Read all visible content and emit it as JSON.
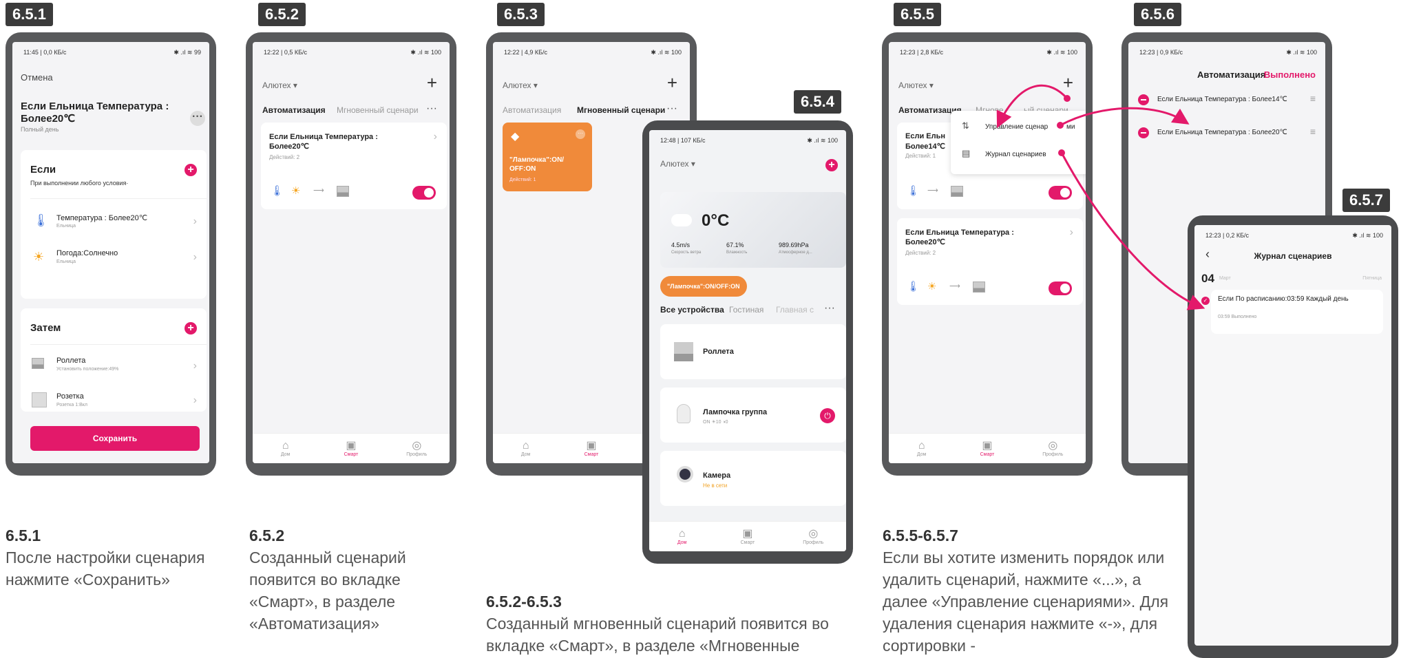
{
  "tags": {
    "t651": "6.5.1",
    "t652": "6.5.2",
    "t653": "6.5.3",
    "t654": "6.5.4",
    "t655": "6.5.5",
    "t656": "6.5.6",
    "t657": "6.5.7"
  },
  "p1": {
    "status": "11:45 | 0,0 КБ/с",
    "status_right": "✱ .ıl ≋ 99",
    "cancel": "Отмена",
    "title": "Если Ельница Температура : Более20℃",
    "subtitle": "Полный день",
    "if_title": "Если",
    "if_sub": "При выполнении любого условия·",
    "cond1": "Температура : Более20℃",
    "cond1_sub": "Ельница",
    "cond2": "Погода:Солнечно",
    "cond2_sub": "Ельница",
    "then_title": "Затем",
    "act1": "Роллета",
    "act1_sub": "Установить положение:49%",
    "act2": "Розетка",
    "act2_sub": "Розетка 1:Вкл",
    "save": "Сохранить"
  },
  "p2": {
    "status": "12:22 | 0,5 КБ/с",
    "status_right": "✱ .ıl ≋ 100",
    "home": "Алютех ▾",
    "tab1": "Автоматизация",
    "tab2": "Мгновенный сценари",
    "card_title": "Если Ельница Температура : Более20℃",
    "card_sub": "Действий: 2"
  },
  "p3": {
    "status": "12:22 | 4,9 КБ/с",
    "status_right": "✱ .ıl ≋ 100",
    "home": "Алютех ▾",
    "tab1": "Автоматизация",
    "tab2": "Мгновенный сценари",
    "scene_title": "\"Лампочка\":ON/ OFF:ON",
    "scene_sub": "Действий: 1"
  },
  "p4": {
    "status": "12:48 | 107 КБ/с",
    "status_right": "✱ .ıl ≋ 100",
    "home": "Алютех ▾",
    "temp": "0°C",
    "wind": "4.5m/s",
    "wind_l": "Скорость ветра",
    "hum": "67.1%",
    "hum_l": "Влажность",
    "press": "989.69hPa",
    "press_l": "Атмосферное д...",
    "chip": "\"Лампочка\":ON/OFF:ON",
    "tab1": "Все устройства",
    "tab2": "Гостиная",
    "tab3": "Главная с",
    "dev1": "Роллета",
    "dev2": "Лампочка группа",
    "dev2_sub": "ON ☀10 ◑0",
    "dev3": "Камера",
    "dev3_sub": "Не в сети"
  },
  "nav": {
    "home": "Дом",
    "smart": "Смарт",
    "profile": "Профиль"
  },
  "p5": {
    "status": "12:23 | 2,8 КБ/с",
    "status_right": "✱ .ıl ≋ 100",
    "home": "Алютех ▾",
    "tab1": "Автоматизация",
    "tab2": "Мгнове",
    "tab2b": "ый сценари",
    "menu1": "Управление сценар",
    "menu1b": "ми",
    "menu2": "Журнал сценариев",
    "card1": "Если Ельн",
    "card1b": "Более14℃",
    "card1_sub": "Действий: 1",
    "card2": "Если Ельница Температура : Более20℃",
    "card2_sub": "Действий: 2"
  },
  "p6": {
    "status": "12:23 | 0,9 КБ/с",
    "status_right": "✱ .ıl ≋ 100",
    "title": "Автоматизация",
    "done": "Выполнено",
    "item1": "Если Ельница Температура : Более14℃",
    "item2": "Если Ельница Температура : Более20℃"
  },
  "p7": {
    "status": "12:23 | 0,2 КБ/с",
    "status_right": "✱ .ıl ≋ 100",
    "title": "Журнал сценариев",
    "day": "04",
    "month": "Март",
    "weekday": "Пятница",
    "log": "Если По расписанию:03:59 Каждый день",
    "log_sub": "03:59 Выполнено"
  },
  "captions": {
    "c1h": "6.5.1",
    "c1": "После настройки сценария нажмите «Сохранить»",
    "c2h": "6.5.2",
    "c2": "Созданный сценарий появится во вкладке «Смарт», в разделе «Автоматизация»",
    "c3h": "6.5.2-6.5.3",
    "c3": "Созданный мгновенный сценарий появится во вкладке «Смарт», в разделе «Мгновенные",
    "c5h": "6.5.5-6.5.7",
    "c5": "Если вы хотите изменить порядок или удалить сценарий, нажмите «...», а далее «Управление сценариями». Для удаления сценария нажмите «-», для сортировки -"
  },
  "colors": {
    "accent": "#e3196a",
    "orange": "#f08a3a"
  }
}
